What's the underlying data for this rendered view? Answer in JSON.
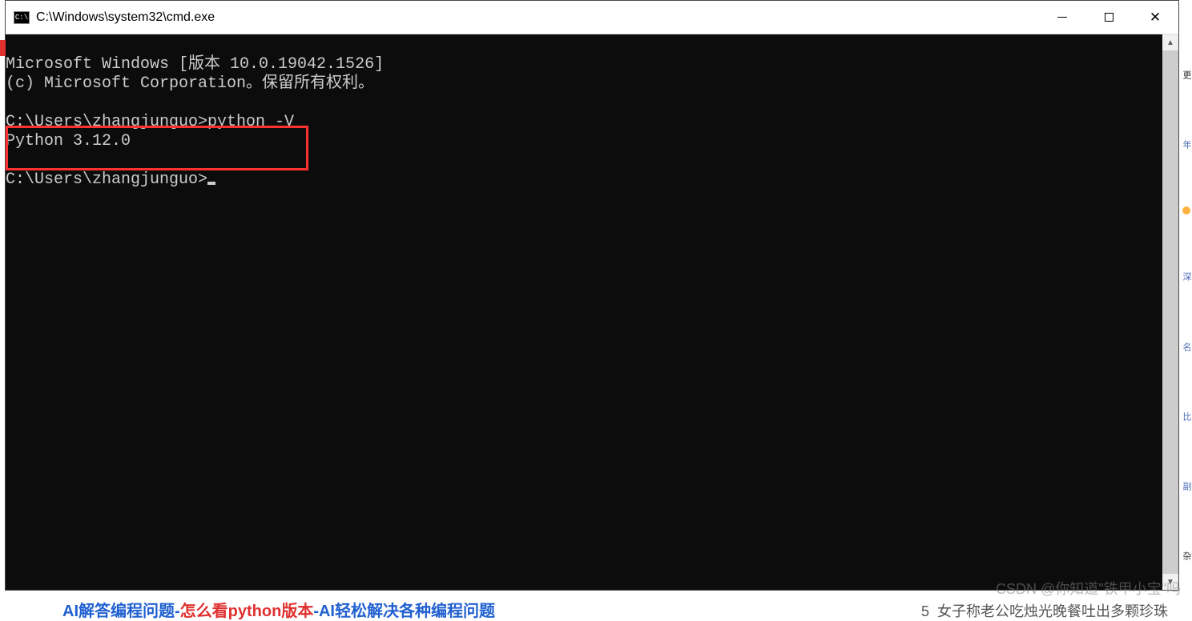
{
  "window": {
    "icon_text": "C:\\",
    "title": "C:\\Windows\\system32\\cmd.exe"
  },
  "terminal": {
    "line1": "Microsoft Windows [版本 10.0.19042.1526]",
    "line2": "(c) Microsoft Corporation。保留所有权利。",
    "line3": "",
    "line4": "C:\\Users\\zhangjunguo>python -V",
    "line5": "Python 3.12.0",
    "line6": "",
    "line7_prompt": "C:\\Users\\zhangjunguo>"
  },
  "sidebar_chars": [
    "更",
    "年",
    "深",
    "名",
    "比",
    "副",
    "杂"
  ],
  "watermark": "CSDN @你知道\"铁甲小宝\"吗",
  "bottom": {
    "part1": "AI解答编程问题-",
    "part2": "怎么看python版本",
    "part3": "-AI轻松解决各种编程问题",
    "right_num": "5",
    "right_text": "女子称老公吃烛光晚餐吐出多颗珍珠"
  }
}
